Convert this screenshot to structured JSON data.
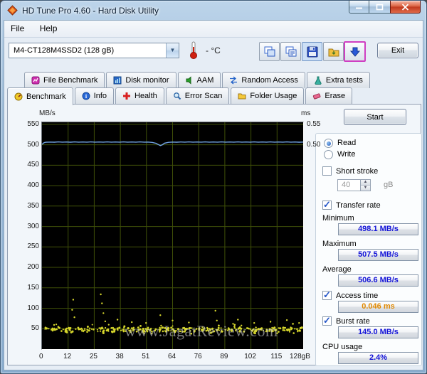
{
  "window": {
    "title": "HD Tune Pro 4.60 - Hard Disk Utility"
  },
  "menu": {
    "file": "File",
    "help": "Help"
  },
  "toolbar": {
    "drive": "M4-CT128M4SSD2 (128 gB)",
    "temperature": "- °C",
    "exit": "Exit"
  },
  "icons": {
    "window": "hdtune-diamond",
    "temperature": "thermometer",
    "toolbar_buttons": [
      "copy-image",
      "copy-text",
      "save-screenshot",
      "export",
      "download-arrow"
    ],
    "caption_buttons": [
      "minimize",
      "maximize",
      "close"
    ]
  },
  "tabs": {
    "row1": [
      {
        "label": "File Benchmark"
      },
      {
        "label": "Disk monitor"
      },
      {
        "label": "AAM"
      },
      {
        "label": "Random Access"
      },
      {
        "label": "Extra tests"
      }
    ],
    "row2": [
      {
        "label": "Benchmark",
        "active": true
      },
      {
        "label": "Info"
      },
      {
        "label": "Health"
      },
      {
        "label": "Error Scan"
      },
      {
        "label": "Folder Usage"
      },
      {
        "label": "Erase"
      }
    ]
  },
  "controls": {
    "start": "Start",
    "read": "Read",
    "write": "Write",
    "short_stroke": "Short stroke",
    "short_stroke_value": "40",
    "short_stroke_unit": "gB",
    "transfer_rate": "Transfer rate",
    "minimum_label": "Minimum",
    "minimum_value": "498.1 MB/s",
    "maximum_label": "Maximum",
    "maximum_value": "507.5 MB/s",
    "average_label": "Average",
    "average_value": "506.6 MB/s",
    "access_time": "Access time",
    "access_time_value": "0.046 ms",
    "burst_rate": "Burst rate",
    "burst_rate_value": "145.0 MB/s",
    "cpu_usage_label": "CPU usage",
    "cpu_usage_value": "2.4%"
  },
  "watermark": "www.JagatReview.com",
  "chart_data": {
    "type": "line",
    "left_axis": {
      "label": "MB/s",
      "ticks": [
        550,
        500,
        450,
        400,
        350,
        300,
        250,
        200,
        150,
        100,
        50
      ],
      "min": 0,
      "max": 555
    },
    "right_axis": {
      "label": "ms",
      "ticks": [
        0.55,
        0.5
      ]
    },
    "x_axis": {
      "tick_labels": [
        "0",
        "12",
        "25",
        "38",
        "51",
        "64",
        "76",
        "89",
        "102",
        "115",
        "128gB"
      ],
      "min": 0,
      "max": 128
    },
    "grid": true,
    "colors": {
      "plot_bg": "#000000",
      "grid": "#3f4f08",
      "transfer_line": "#74a6e8",
      "access_dots": "#d6d62c"
    },
    "note": "transfer rate line in MB/s (left axis); access-time dots plotted on left-axis scale, ms = y/1000 (right axis)",
    "transfer_rate_points": [
      [
        0,
        501
      ],
      [
        1,
        505
      ],
      [
        2,
        506.2
      ],
      [
        4,
        506.6
      ],
      [
        6,
        506.2
      ],
      [
        8,
        506.9
      ],
      [
        10,
        506.4
      ],
      [
        12,
        506.8
      ],
      [
        14,
        506.3
      ],
      [
        16,
        506.9
      ],
      [
        18,
        506.5
      ],
      [
        20,
        506.8
      ],
      [
        22,
        506.4
      ],
      [
        24,
        506.9
      ],
      [
        26,
        506.5
      ],
      [
        28,
        506.8
      ],
      [
        30,
        506.4
      ],
      [
        32,
        506.9
      ],
      [
        34,
        506.5
      ],
      [
        36,
        506.8
      ],
      [
        38,
        506.4
      ],
      [
        40,
        506.9
      ],
      [
        42,
        506.5
      ],
      [
        44,
        506.8
      ],
      [
        46,
        506.4
      ],
      [
        48,
        506.9
      ],
      [
        50,
        506.5
      ],
      [
        52,
        506.7
      ],
      [
        54,
        505.8
      ],
      [
        56,
        503.5
      ],
      [
        57,
        500.5
      ],
      [
        58,
        498.1
      ],
      [
        59,
        500
      ],
      [
        60,
        503.8
      ],
      [
        62,
        506
      ],
      [
        64,
        506.6
      ],
      [
        66,
        506.3
      ],
      [
        68,
        506.8
      ],
      [
        70,
        506.5
      ],
      [
        72,
        506.9
      ],
      [
        74,
        506.4
      ],
      [
        76,
        506.8
      ],
      [
        78,
        506.5
      ],
      [
        80,
        506.9
      ],
      [
        82,
        506.4
      ],
      [
        84,
        506.8
      ],
      [
        86,
        506.5
      ],
      [
        88,
        506.9
      ],
      [
        90,
        506.4
      ],
      [
        92,
        506.8
      ],
      [
        94,
        506.5
      ],
      [
        96,
        506.9
      ],
      [
        98,
        506.4
      ],
      [
        100,
        506.8
      ],
      [
        102,
        506.5
      ],
      [
        104,
        506.9
      ],
      [
        106,
        506.4
      ],
      [
        108,
        506.8
      ],
      [
        110,
        506.5
      ],
      [
        112,
        506.9
      ],
      [
        114,
        506.4
      ],
      [
        116,
        506.8
      ],
      [
        118,
        506.5
      ],
      [
        120,
        506.9
      ],
      [
        122,
        506.4
      ],
      [
        124,
        506.8
      ],
      [
        126,
        506.3
      ],
      [
        128,
        506.6
      ]
    ],
    "access_time_scatter": {
      "seed": 1337,
      "x_min": 0.5,
      "x_max": 127.5,
      "bands": [
        {
          "count": 230,
          "y_min": 42,
          "y_max": 53
        },
        {
          "count": 70,
          "y_min": 38,
          "y_max": 62
        }
      ]
    },
    "access_time_outliers": [
      [
        14.8,
        96
      ],
      [
        15.3,
        121
      ],
      [
        15.9,
        78
      ],
      [
        28.8,
        134
      ],
      [
        29.4,
        112
      ],
      [
        30.1,
        88
      ],
      [
        31,
        68
      ],
      [
        37,
        72
      ],
      [
        44,
        66
      ],
      [
        51,
        64
      ],
      [
        58,
        83
      ],
      [
        64,
        70
      ],
      [
        72,
        65
      ],
      [
        85,
        94
      ],
      [
        85.7,
        70
      ],
      [
        96,
        72
      ],
      [
        104,
        64
      ],
      [
        112,
        67
      ],
      [
        120,
        71
      ],
      [
        126,
        64
      ]
    ]
  }
}
